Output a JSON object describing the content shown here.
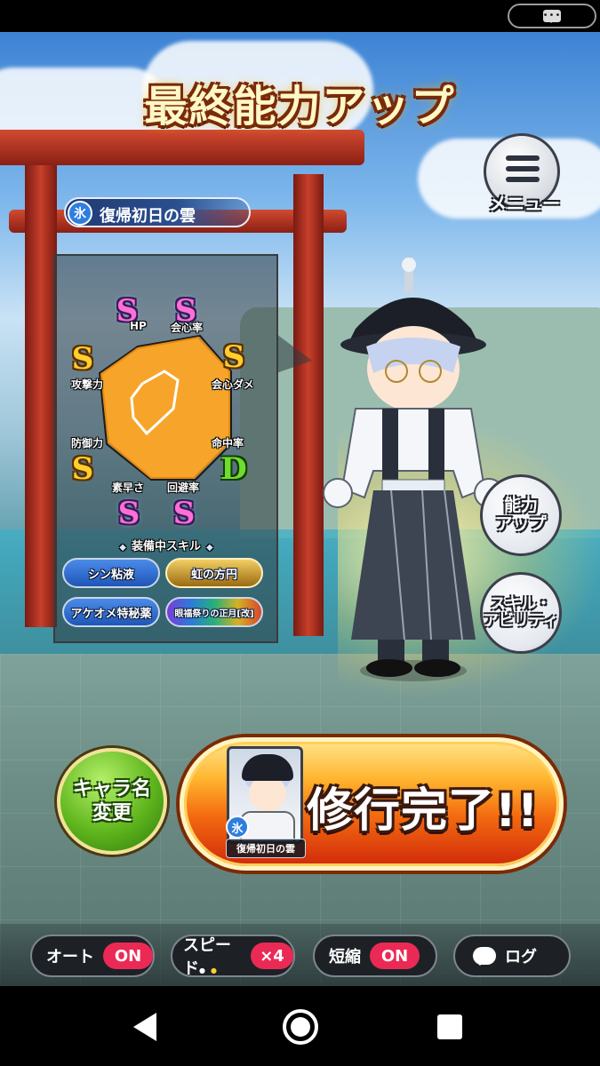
{
  "screen": {
    "title": "最終能力アップ",
    "menu_label": "メニュー"
  },
  "character": {
    "element": "氷",
    "name": "復帰初日の雲"
  },
  "stats": [
    {
      "key": "hp",
      "label": "HP",
      "rank": "S",
      "style": "rainbow"
    },
    {
      "key": "crit_rate",
      "label": "会心率",
      "rank": "S",
      "style": "rainbow"
    },
    {
      "key": "attack",
      "label": "攻撃力",
      "rank": "S",
      "style": "gold"
    },
    {
      "key": "crit_damage",
      "label": "会心ダメ",
      "rank": "S",
      "style": "gold"
    },
    {
      "key": "defense",
      "label": "防御力",
      "rank": "S",
      "style": "gold"
    },
    {
      "key": "accuracy",
      "label": "命中率",
      "rank": "D",
      "style": "green"
    },
    {
      "key": "speed",
      "label": "素早さ",
      "rank": "S",
      "style": "rainbow"
    },
    {
      "key": "evasion",
      "label": "回避率",
      "rank": "S",
      "style": "rainbow"
    }
  ],
  "skills": {
    "header": "装備中スキル",
    "items": [
      "シン粘液",
      "虹の方円",
      "アケオメ特秘薬",
      "眼福祭りの正月[改]"
    ]
  },
  "side_buttons": {
    "ability_up": "能力\nアップ",
    "skill_ability": "スキル・\nアビリティ"
  },
  "actions": {
    "rename": "キャラ名\n変更",
    "complete": "修行完了!!"
  },
  "controls": {
    "auto_label": "オート",
    "auto_state": "ON",
    "speed_label": "スピード",
    "speed_value": "×4",
    "shorten_label": "短縮",
    "shorten_state": "ON",
    "log_label": "ログ"
  },
  "colors": {
    "accent_red": "#ea2a55",
    "complete_orange": "#f36a10",
    "rename_green": "#5fb51d",
    "radar_fill": "#f7a52a"
  }
}
